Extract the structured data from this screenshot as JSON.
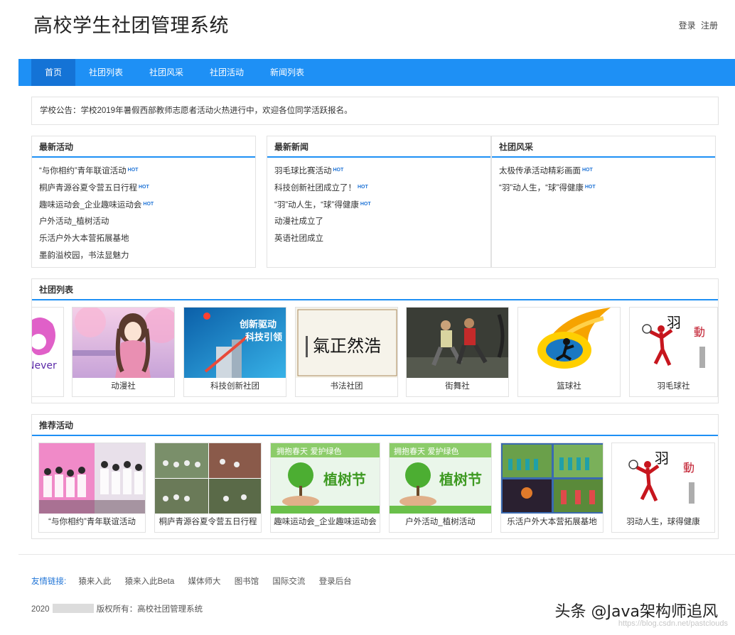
{
  "header": {
    "title": "高校学生社团管理系统",
    "login": "登录",
    "register": "注册"
  },
  "nav": {
    "items": [
      {
        "label": "首页",
        "active": true
      },
      {
        "label": "社团列表"
      },
      {
        "label": "社团风采"
      },
      {
        "label": "社团活动"
      },
      {
        "label": "新闻列表"
      }
    ]
  },
  "notice": {
    "text": "学校公告：学校2019年暑假西部教师志愿者活动火热进行中，欢迎各位同学活跃报名。"
  },
  "latest_activities": {
    "title": "最新活动",
    "items": [
      {
        "text": "“与你相约”青年联谊活动",
        "hot": true
      },
      {
        "text": "桐庐青源谷夏令营五日行程",
        "hot": true
      },
      {
        "text": "趣味运动会_企业趣味运动会",
        "hot": true
      },
      {
        "text": "户外活动_植树活动",
        "hot": false
      },
      {
        "text": "乐活户外大本营拓展基地",
        "hot": false
      },
      {
        "text": "墨韵溢校园，书法显魅力",
        "hot": false
      }
    ]
  },
  "latest_news": {
    "title": "最新新闻",
    "items": [
      {
        "text": "羽毛球比赛活动",
        "hot": true
      },
      {
        "text": "科技创新社团成立了！",
        "hot": true
      },
      {
        "text": "“羽”动人生，“球”得健康",
        "hot": true
      },
      {
        "text": "动漫社成立了",
        "hot": false
      },
      {
        "text": "英语社团成立",
        "hot": false
      }
    ]
  },
  "club_style": {
    "title": "社团风采",
    "items": [
      {
        "text": "太极传承活动精彩画面",
        "hot": true
      },
      {
        "text": "“羽”动人生，“球”得健康",
        "hot": true
      }
    ]
  },
  "hot_label": "HOT",
  "club_list": {
    "title": "社团列表",
    "cards": [
      {
        "name": "",
        "thumb": "partial-logo"
      },
      {
        "name": "动漫社",
        "thumb": "anime"
      },
      {
        "name": "科技创新社团",
        "thumb": "tech"
      },
      {
        "name": "书法社团",
        "thumb": "calligraphy"
      },
      {
        "name": "街舞社",
        "thumb": "dance"
      },
      {
        "name": "篮球社",
        "thumb": "basketball"
      },
      {
        "name": "羽毛球社",
        "thumb": "badminton"
      }
    ]
  },
  "recommended": {
    "title": "推荐活动",
    "cards": [
      {
        "name": "“与你相约”青年联谊活动",
        "thumb": "group-photo"
      },
      {
        "name": "桐庐青源谷夏令营五日行程",
        "thumb": "camp"
      },
      {
        "name": "趣味运动会_企业趣味运动会",
        "thumb": "tree"
      },
      {
        "name": "户外活动_植树活动",
        "thumb": "tree"
      },
      {
        "name": "乐活户外大本营拓展基地",
        "thumb": "outdoor"
      },
      {
        "name": "羽动人生，球得健康",
        "thumb": "badminton"
      }
    ]
  },
  "thumb_text": {
    "tech": "创新驱动\n科技引领",
    "calligraphy": "浩然正气",
    "tree_banner": "拥抱春天 爱护绿色",
    "tree_title": "植树节",
    "badminton": "羽动人生",
    "logo_fragment": "Never"
  },
  "footer": {
    "links_label": "友情链接:",
    "links": [
      "猿来入此",
      "猿来入此Beta",
      "媒体师大",
      "图书馆",
      "国际交流",
      "登录后台"
    ],
    "copyright_year": "2020",
    "copyright_text": "版权所有：高校社团管理系统"
  },
  "watermark": {
    "text": "头条 @Java架构师追风",
    "url": "https://blog.csdn.net/pastclouds"
  }
}
